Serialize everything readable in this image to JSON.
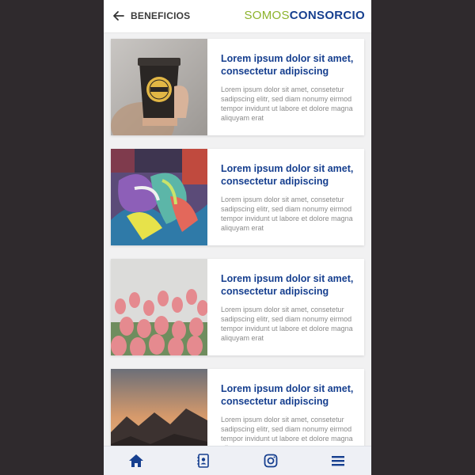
{
  "header": {
    "title": "BENEFICIOS",
    "logo_part1": "SOMOS",
    "logo_part2": "CONSORCIO",
    "back_icon": "arrow-left-icon"
  },
  "colors": {
    "primary": "#163f8f",
    "logo_green": "#8cb32b",
    "muted_text": "#8a8a8a",
    "background": "#f1f1f2"
  },
  "benefits": [
    {
      "title": "Lorem ipsum dolor sit amet, consectetur adipiscing",
      "text": "Lorem ipsum dolor sit amet, consetetur sadipscing elitr, sed diam nonumy eirmod tempor invidunt ut labore et dolore magna aliquyam erat",
      "image": "coffee-cup-photo"
    },
    {
      "title": "Lorem ipsum dolor sit amet, consectetur adipiscing",
      "text": "Lorem ipsum dolor sit amet, consetetur sadipscing elitr, sed diam nonumy eirmod tempor invidunt ut labore et dolore magna aliquyam erat",
      "image": "graffiti-wall-photo"
    },
    {
      "title": "Lorem ipsum dolor sit amet, consectetur adipiscing",
      "text": "Lorem ipsum dolor sit amet, consetetur sadipscing elitr, sed diam nonumy eirmod tempor invidunt ut labore et dolore magna aliquyam erat",
      "image": "pink-tulips-photo"
    },
    {
      "title": "Lorem ipsum dolor sit amet, consectetur adipiscing",
      "text": "Lorem ipsum dolor sit amet, consetetur sadipscing elitr, sed diam nonumy eirmod tempor invidunt ut labore et dolore magna aliquyam erat",
      "image": "mountain-sunset-photo"
    }
  ],
  "bottom_nav": [
    {
      "icon": "home-icon",
      "active": true
    },
    {
      "icon": "contacts-icon",
      "active": false
    },
    {
      "icon": "instagram-icon",
      "active": false
    },
    {
      "icon": "menu-icon",
      "active": false
    }
  ]
}
